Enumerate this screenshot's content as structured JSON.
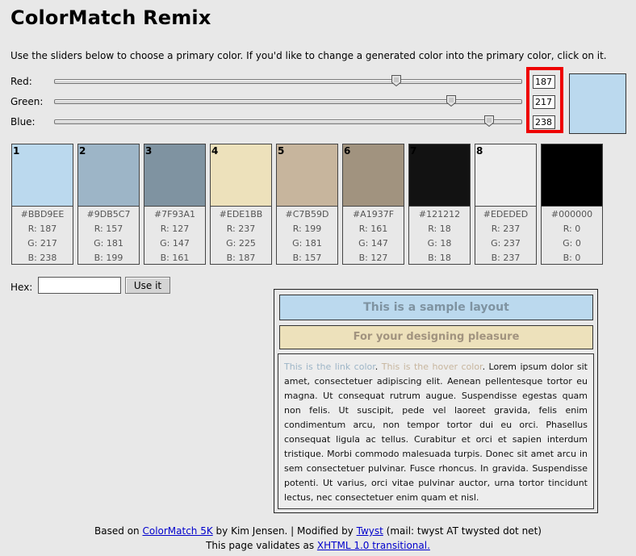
{
  "title": "ColorMatch Remix",
  "intro": "Use the sliders below to choose a primary color. If you'd like to change a generated color into the primary color, click on it.",
  "sliders": [
    {
      "label": "Red:",
      "value": "187",
      "fraction": 0.733
    },
    {
      "label": "Green:",
      "value": "217",
      "fraction": 0.851
    },
    {
      "label": "Blue:",
      "value": "238",
      "fraction": 0.933
    }
  ],
  "primary_color": "#BBD9EE",
  "highlight_color": "#EE0000",
  "swatches": [
    {
      "num": "1",
      "color": "#BBD9EE",
      "hex": "#BBD9EE",
      "r": "R: 187",
      "g": "G: 217",
      "b": "B: 238"
    },
    {
      "num": "2",
      "color": "#9DB5C7",
      "hex": "#9DB5C7",
      "r": "R: 157",
      "g": "G: 181",
      "b": "B: 199"
    },
    {
      "num": "3",
      "color": "#7F93A1",
      "hex": "#7F93A1",
      "r": "R: 127",
      "g": "G: 147",
      "b": "B: 161"
    },
    {
      "num": "4",
      "color": "#EDE1BB",
      "hex": "#EDE1BB",
      "r": "R: 237",
      "g": "G: 225",
      "b": "B: 187"
    },
    {
      "num": "5",
      "color": "#C7B59D",
      "hex": "#C7B59D",
      "r": "R: 199",
      "g": "G: 181",
      "b": "B: 157"
    },
    {
      "num": "6",
      "color": "#A1937F",
      "hex": "#A1937F",
      "r": "R: 161",
      "g": "G: 147",
      "b": "B: 127"
    },
    {
      "num": "7",
      "color": "#121212",
      "hex": "#121212",
      "r": "R: 18",
      "g": "G: 18",
      "b": "B: 18"
    },
    {
      "num": "8",
      "color": "#EDEDED",
      "hex": "#EDEDED",
      "r": "R: 237",
      "g": "G: 237",
      "b": "B: 237"
    },
    {
      "num": "",
      "color": "#000000",
      "hex": "#000000",
      "r": "R: 0",
      "g": "G: 0",
      "b": "B: 0"
    }
  ],
  "hex_form": {
    "label": "Hex:",
    "value": "",
    "button": "Use it"
  },
  "sample": {
    "heading": "This is a sample layout",
    "subheading": "For your designing pleasure",
    "link_text": "This is the link color",
    "sep1": ". ",
    "hover_text": "This is the hover color",
    "sep2": ". ",
    "body": "Lorem ipsum dolor sit amet, consectetuer adipiscing elit. Aenean pellentesque tortor eu magna. Ut consequat rutrum augue. Suspendisse egestas quam non felis. Ut suscipit, pede vel laoreet gravida, felis enim condimentum arcu, non tempor tortor dui eu orci. Phasellus consequat ligula ac tellus. Curabitur et orci et sapien interdum tristique. Morbi commodo malesuada turpis. Donec sit amet arcu in sem consectetuer pulvinar. Fusce rhoncus. In gravida. Suspendisse potenti. Ut varius, orci vitae pulvinar auctor, urna tortor tincidunt lectus, nec consectetuer enim quam et nisl."
  },
  "footer": {
    "line1_pre": "Based on ",
    "colormatch_link": "ColorMatch 5K",
    "line1_mid": " by Kim Jensen. | Modified by ",
    "twyst_link": "Twyst",
    "line1_post": " (mail: twyst AT twysted dot net)",
    "line2_pre": "This page validates as ",
    "xhtml_link": "XHTML 1.0 transitional."
  }
}
